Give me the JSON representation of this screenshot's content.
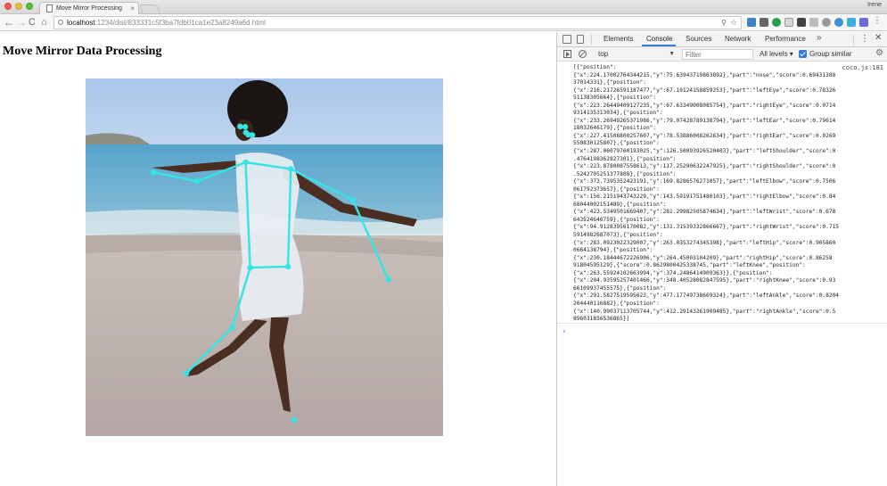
{
  "browser": {
    "tab_title": "Move Mirror Processing",
    "tab_close": "×",
    "profile": "Irene",
    "url_host": "localhost",
    "url_path": ":1234/dist/833331c5f3ba7fdb01ca1e23a8249a6d.html",
    "nav": {
      "back": "←",
      "forward": "→",
      "reload": "C",
      "home": "⌂"
    },
    "icons": {
      "zoom": "⚲",
      "star": "☆"
    }
  },
  "page": {
    "title": "Move Mirror Data Processing",
    "skeleton_color": "#34e5e5"
  },
  "devtools": {
    "tabs": [
      "Elements",
      "Console",
      "Sources",
      "Network",
      "Performance"
    ],
    "active_tab": "Console",
    "more": "»",
    "kebab": "⋮",
    "close": "✕",
    "context": "top",
    "filter_placeholder": "Filter",
    "levels": "All levels ▾",
    "group_similar": "Group similar",
    "gear": "⚙",
    "prompt": "›",
    "log": {
      "source": "coco.js:181",
      "lines": [
        "[{\"position\":",
        "{\"x\":224.17002764344215,\"y\":75.63943719863892},\"part\":\"nose\",\"score\":0.69431388",
        "37014331},{\"position\":",
        "{\"x\":216.21726591187477,\"y\":67.10124158859253},\"part\":\"leftEye\",\"score\":0.78326",
        "51138305664},{\"position\":",
        "{\"x\":223.26449409127235,\"y\":67.63349008085754},\"part\":\"rightEye\",\"score\":0.0714",
        "9314135313034},{\"position\":",
        "{\"x\":233.26949265371986,\"y\":79.07428789138794},\"part\":\"leftEar\",\"score\":0.79614",
        "18032646179},{\"position\":",
        "{\"x\":227.41508800257607,\"y\":78.53886008262634},\"part\":\"rightEar\",\"score\":0.0269",
        "550830125807},{\"position\":",
        "{\"x\":287.06079760193025,\"y\":126.50093926520403},\"part\":\"leftShoulder\",\"score\":0",
        ".4764198362827301},{\"position\":",
        "{\"x\":223.8780087558613,\"y\":117.25290632247925},\"part\":\"rightShoulder\",\"score\":0",
        ".5242705251377808},{\"position\":",
        "{\"x\":373.7395352423191,\"y\":169.8286576271057},\"part\":\"leftElbow\",\"score\":0.7506",
        "061792373657},{\"position\":",
        "{\"x\":156.2151943743229,\"y\":143.59191751480103},\"part\":\"rightElbow\",\"score\":0.84",
        "68044002151489},{\"position\":",
        "{\"x\":423.5349501669407,\"y\":281.29982505874634},\"part\":\"leftWrist\",\"score\":0.678",
        "643524646759},{\"position\":",
        "{\"x\":94.91283956170082,\"y\":131.31539332866667},\"part\":\"rightWrist\",\"score\":0.715",
        "5914982687073},{\"position\":",
        "{\"x\":283.0923022329007,\"y\":263.0353274345398},\"part\":\"leftHip\",\"score\":0.905860",
        "0664138794},{\"position\":",
        "{\"x\":230.18444672226906,\"y\":264.45003104209},\"part\":\"rightHip\",\"score\":0.86258",
        "91804595129},{\"score\":0.8629800425338745,\"part\":\"leftKnee\",\"position\":",
        "{\"x\":263.55924102663994,\"y\":374.2486414909363}},{\"position\":",
        "{\"x\":204.93595257401466,\"y\":348.40528082847595},\"part\":\"rightKnee\",\"score\":0.93",
        "66109937455575},{\"position\":",
        "{\"x\":291.5827519595623,\"y\":477.17749738669324},\"part\":\"leftAnkle\",\"score\":0.8204",
        "204440116882},{\"position\":",
        "{\"x\":140.99037113705744,\"y\":412.29143261909485},\"part\":\"rightAnkle\",\"score\":0.5",
        "896031856536865}]"
      ]
    }
  }
}
